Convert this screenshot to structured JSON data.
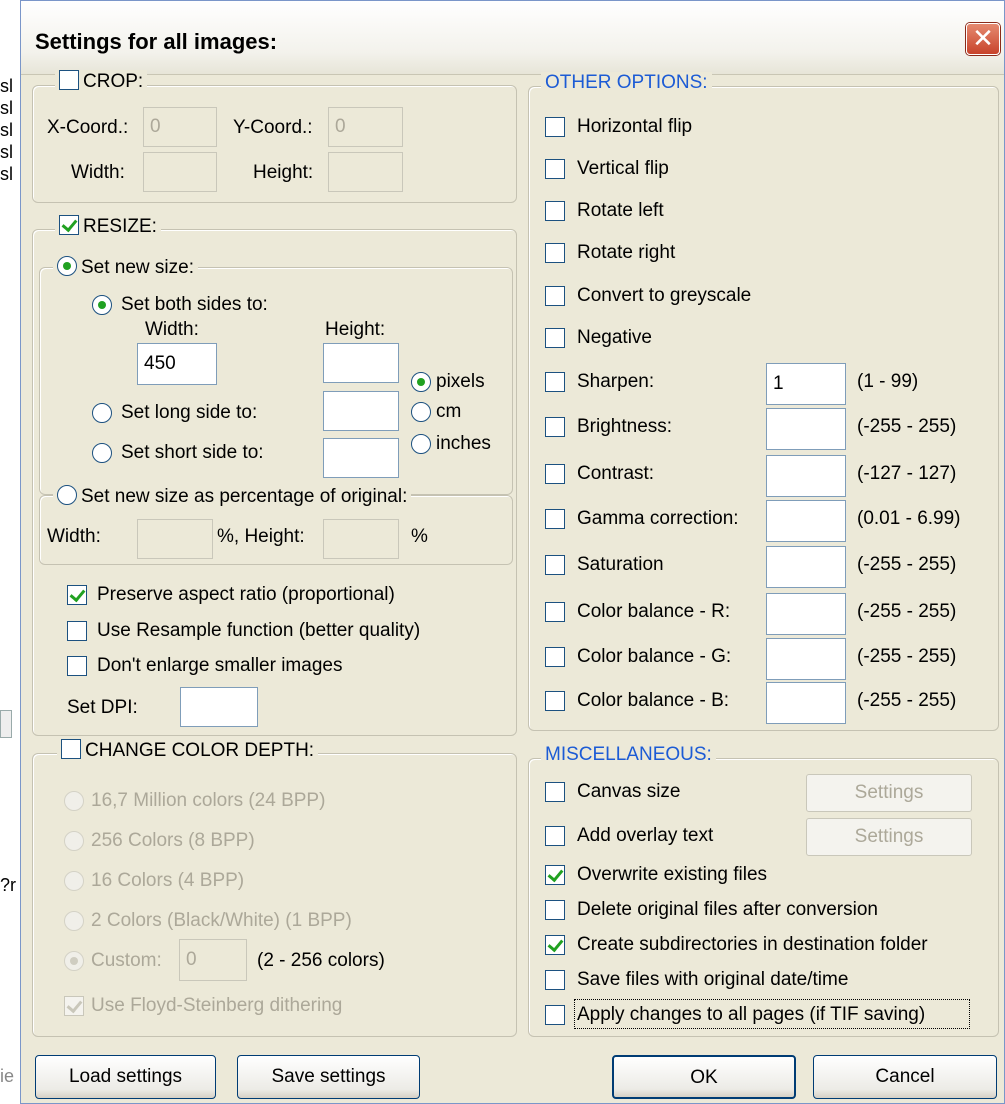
{
  "background_left": {
    "fragments": [
      "sl",
      "sl",
      "sl",
      "sl",
      "sl",
      "?r",
      "ie"
    ]
  },
  "window": {
    "title": "Settings for all images:",
    "close_symbol": "✕"
  },
  "crop": {
    "label": "CROP:",
    "checked": false,
    "x_label": "X-Coord.:",
    "x_value": "0",
    "y_label": "Y-Coord.:",
    "y_value": "0",
    "width_label": "Width:",
    "width_value": "",
    "height_label": "Height:",
    "height_value": ""
  },
  "resize": {
    "label": "RESIZE:",
    "checked": true,
    "set_new_size": "Set new size:",
    "set_both": "Set both sides to:",
    "width_label": "Width:",
    "width_value": "450",
    "height_label": "Height:",
    "height_value": "",
    "set_long": "Set long side to:",
    "long_value": "",
    "set_short": "Set short side to:",
    "short_value": "",
    "unit_pixels": "pixels",
    "unit_cm": "cm",
    "unit_inches": "inches",
    "percent_label": "Set new size as percentage of original:",
    "pct_width_label": "Width:",
    "pct_width_value": "",
    "pct_height_label": "%, Height:",
    "pct_height_value": "",
    "pct_unit": "%",
    "preserve": "Preserve aspect ratio (proportional)",
    "preserve_checked": true,
    "resample": "Use Resample function (better quality)",
    "resample_checked": false,
    "no_enlarge": "Don't enlarge smaller images",
    "no_enlarge_checked": false,
    "dpi_label": "Set DPI:",
    "dpi_value": ""
  },
  "color_depth": {
    "label": "CHANGE COLOR DEPTH:",
    "checked": false,
    "opt1": "16,7 Million colors (24 BPP)",
    "opt2": "256 Colors (8 BPP)",
    "opt3": "16 Colors (4 BPP)",
    "opt4": "2 Colors (Black/White) (1 BPP)",
    "custom_label": "Custom:",
    "custom_value": "0",
    "custom_range": "(2 - 256 colors)",
    "dither": "Use Floyd-Steinberg dithering",
    "dither_checked": true
  },
  "other": {
    "label": "OTHER OPTIONS:",
    "hflip": "Horizontal flip",
    "vflip": "Vertical flip",
    "rleft": "Rotate left",
    "rright": "Rotate right",
    "grey": "Convert to greyscale",
    "negative": "Negative",
    "sharpen": "Sharpen:",
    "sharpen_value": "1",
    "sharpen_range": "(1 - 99)",
    "brightness": "Brightness:",
    "brightness_value": "",
    "brightness_range": "(-255 - 255)",
    "contrast": "Contrast:",
    "contrast_value": "",
    "contrast_range": "(-127 - 127)",
    "gamma": "Gamma correction:",
    "gamma_value": "",
    "gamma_range": "(0.01 - 6.99)",
    "saturation": "Saturation",
    "saturation_value": "",
    "saturation_range": "(-255 - 255)",
    "cbr": "Color balance - R:",
    "cbr_value": "",
    "cbr_range": "(-255 - 255)",
    "cbg": "Color balance - G:",
    "cbg_value": "",
    "cbg_range": "(-255 - 255)",
    "cbb": "Color balance - B:",
    "cbb_value": "",
    "cbb_range": "(-255 - 255)"
  },
  "misc": {
    "label": "MISCELLANEOUS:",
    "canvas": "Canvas size",
    "canvas_checked": false,
    "canvas_btn": "Settings",
    "overlay": "Add overlay text",
    "overlay_checked": false,
    "overlay_btn": "Settings",
    "overwrite": "Overwrite existing files",
    "overwrite_checked": true,
    "delete": "Delete original files after conversion",
    "delete_checked": false,
    "subdirs": "Create subdirectories in destination folder",
    "subdirs_checked": true,
    "datetime": "Save files with original date/time",
    "datetime_checked": false,
    "allpages": "Apply changes to all pages (if TIF saving)",
    "allpages_checked": false
  },
  "buttons": {
    "load": "Load settings",
    "save": "Save settings",
    "ok": "OK",
    "cancel": "Cancel"
  }
}
